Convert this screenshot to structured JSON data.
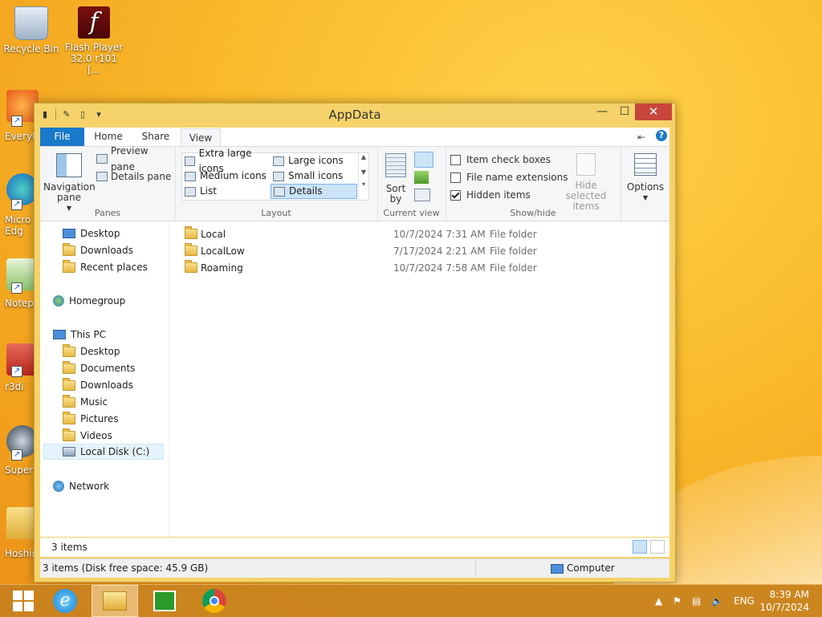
{
  "desktop": {
    "icons": [
      {
        "label": "Recycle Bin",
        "icon": "recycle-bin-icon"
      },
      {
        "label": "Flash Player 32.0 r101 [...",
        "icon": "flash-player-icon"
      }
    ],
    "partial_icons": [
      {
        "label": "Everyt",
        "icon": "everything-icon"
      },
      {
        "label": "Micro Edg",
        "icon": "edge-icon"
      },
      {
        "label": "Notep",
        "icon": "notepad-icon"
      },
      {
        "label": "r3di",
        "icon": "r3d-icon"
      },
      {
        "label": "Super",
        "icon": "super-icon"
      },
      {
        "label": "Hoshin",
        "icon": "folder-icon"
      }
    ]
  },
  "window": {
    "title": "AppData",
    "controls": {
      "minimize": "—",
      "maximize": "☐",
      "close": "✕"
    },
    "tabs": {
      "file": "File",
      "home": "Home",
      "share": "Share",
      "view": "View"
    },
    "ribbon": {
      "panes": {
        "navigation_pane": "Navigation pane",
        "preview_pane": "Preview pane",
        "details_pane": "Details pane",
        "label": "Panes"
      },
      "layout": {
        "items": [
          "Extra large icons",
          "Large icons",
          "Medium icons",
          "Small icons",
          "List",
          "Details"
        ],
        "selected": "Details",
        "label": "Layout"
      },
      "current_view": {
        "sort_by": "Sort by",
        "label": "Current view"
      },
      "show_hide": {
        "item_check_boxes": {
          "label": "Item check boxes",
          "checked": false
        },
        "file_name_extensions": {
          "label": "File name extensions",
          "checked": false
        },
        "hidden_items": {
          "label": "Hidden items",
          "checked": true
        },
        "hide_selected_items": "Hide selected items",
        "label": "Show/hide"
      },
      "options": "Options"
    },
    "nav": {
      "favorites": [
        "Desktop",
        "Downloads",
        "Recent places"
      ],
      "homegroup": "Homegroup",
      "this_pc": "This PC",
      "this_pc_items": [
        "Desktop",
        "Documents",
        "Downloads",
        "Music",
        "Pictures",
        "Videos",
        "Local Disk (C:)"
      ],
      "network": "Network"
    },
    "files": [
      {
        "name": "Local",
        "date": "10/7/2024 7:31 AM",
        "type": "File folder"
      },
      {
        "name": "LocalLow",
        "date": "7/17/2024 2:21 AM",
        "type": "File folder"
      },
      {
        "name": "Roaming",
        "date": "10/7/2024 7:58 AM",
        "type": "File folder"
      }
    ],
    "status": {
      "count": "3 items"
    },
    "info": {
      "left": "3 items (Disk free space: 45.9 GB)",
      "right": "Computer"
    }
  },
  "taskbar": {
    "apps": [
      "start-icon",
      "internet-explorer-icon",
      "file-explorer-icon",
      "store-icon",
      "chrome-icon"
    ],
    "lang": "ENG",
    "time": "8:39 AM",
    "date": "10/7/2024"
  },
  "colors": {
    "accent": "#1979ca",
    "window_frame": "#f5d36a",
    "close": "#c7453b"
  }
}
